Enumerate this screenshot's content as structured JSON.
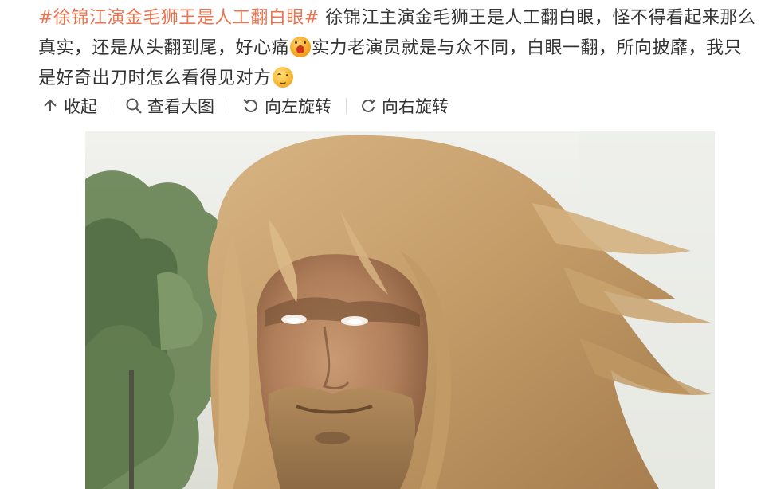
{
  "post": {
    "hashtag": "#徐锦江演金毛狮王是人工翻白眼#",
    "text_part1": " 徐锦江主演金毛狮王是人工翻白眼，怪不得看起来那么真实，还是从头翻到尾，好心痛",
    "emoji1": "heartbroken-emoji",
    "text_part2": "实力老演员就是与众不同，白眼一翻，所向披靡，我只是好奇出刀时怎么看得见对方",
    "emoji2": "curious-emoji"
  },
  "actions": {
    "collapse": {
      "label": "收起",
      "icon": "collapse-up-icon"
    },
    "view_large": {
      "label": "查看大图",
      "icon": "magnifier-icon"
    },
    "rotate_left": {
      "label": "向左旋转",
      "icon": "rotate-left-icon"
    },
    "rotate_right": {
      "label": "向右旋转",
      "icon": "rotate-right-icon"
    }
  },
  "image": {
    "description_icon": "photo-of-long-haired-man-with-white-eyes",
    "colors": {
      "sky": "#e9ebe6",
      "trees": "#5f7a4e",
      "hair": "#c9a06a",
      "skin": "#b78763"
    }
  },
  "colors": {
    "hashtag": "#eb7350",
    "text": "#333333",
    "separator": "#d9d9d9"
  }
}
